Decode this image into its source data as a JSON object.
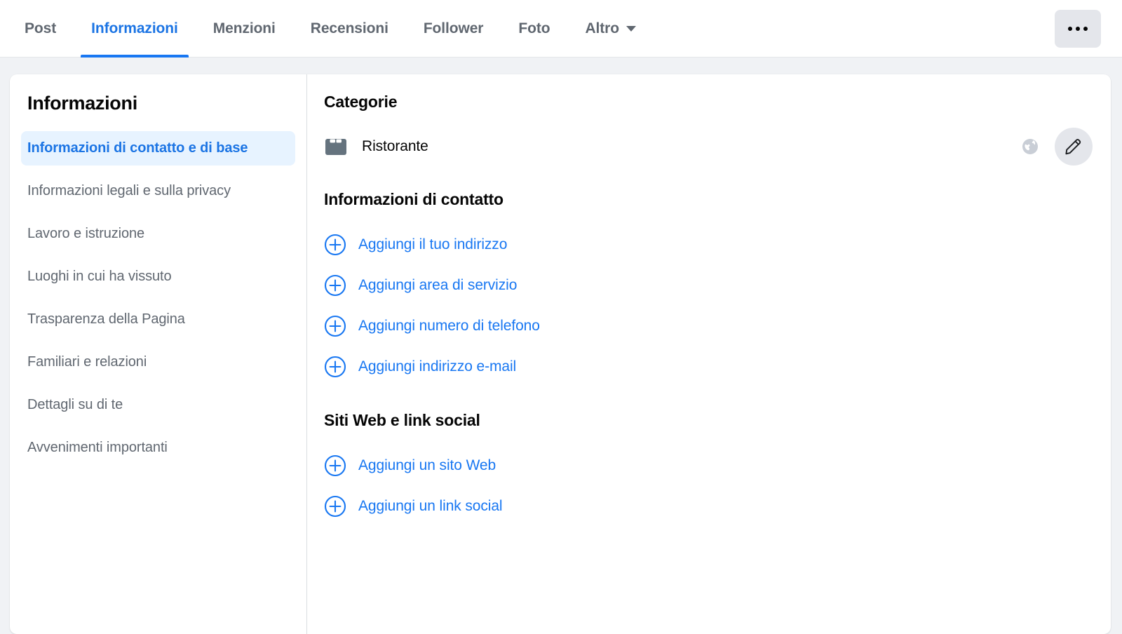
{
  "topnav": {
    "tabs": [
      {
        "label": "Post",
        "active": false,
        "caret": false
      },
      {
        "label": "Informazioni",
        "active": true,
        "caret": false
      },
      {
        "label": "Menzioni",
        "active": false,
        "caret": false
      },
      {
        "label": "Recensioni",
        "active": false,
        "caret": false
      },
      {
        "label": "Follower",
        "active": false,
        "caret": false
      },
      {
        "label": "Foto",
        "active": false,
        "caret": false
      },
      {
        "label": "Altro",
        "active": false,
        "caret": true
      }
    ],
    "more_button": {
      "icon": "ellipsis-horizontal-icon",
      "aria_label": "Altre opzioni"
    }
  },
  "sidebar": {
    "title": "Informazioni",
    "items": [
      {
        "label": "Informazioni di contatto e di base",
        "active": true
      },
      {
        "label": "Informazioni legali e sulla privacy",
        "active": false
      },
      {
        "label": "Lavoro e istruzione",
        "active": false
      },
      {
        "label": "Luoghi in cui ha vissuto",
        "active": false
      },
      {
        "label": "Trasparenza della Pagina",
        "active": false
      },
      {
        "label": "Familiari e relazioni",
        "active": false
      },
      {
        "label": "Dettagli su di te",
        "active": false
      },
      {
        "label": "Avvenimenti importanti",
        "active": false
      }
    ]
  },
  "content": {
    "categories": {
      "title": "Categorie",
      "row": {
        "icon": "briefcase-icon",
        "label": "Ristorante",
        "visibility_icon": "globe-public-icon",
        "edit_icon": "pencil-edit-icon"
      }
    },
    "contact_info": {
      "title": "Informazioni di contatto",
      "links": [
        {
          "icon": "plus-circle-icon",
          "label": "Aggiungi il tuo indirizzo"
        },
        {
          "icon": "plus-circle-icon",
          "label": "Aggiungi area di servizio"
        },
        {
          "icon": "plus-circle-icon",
          "label": "Aggiungi numero di telefono"
        },
        {
          "icon": "plus-circle-icon",
          "label": "Aggiungi indirizzo e-mail"
        }
      ]
    },
    "websites_social": {
      "title": "Siti Web e link social",
      "links": [
        {
          "icon": "plus-circle-icon",
          "label": "Aggiungi un sito Web"
        },
        {
          "icon": "plus-circle-icon",
          "label": "Aggiungi un link social"
        }
      ]
    }
  },
  "colors": {
    "accent_blue": "#1877F2",
    "link_blue": "#1B74E4",
    "active_nav_bg": "#E7F3FF",
    "page_bg": "#F0F2F5",
    "card_bg": "#FFFFFF",
    "text_primary": "#050505",
    "text_secondary": "#606770",
    "icon_gray": "#65737E",
    "button_gray": "#E4E6EB"
  }
}
